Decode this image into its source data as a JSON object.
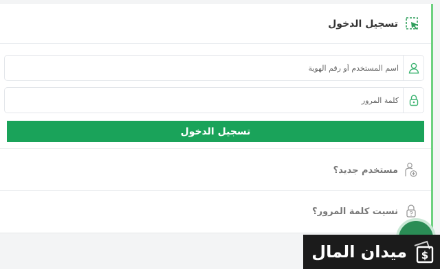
{
  "header": {
    "title": "تسجيل الدخول",
    "icon": "pointer-select-icon"
  },
  "form": {
    "username_placeholder": "اسم المستخدم أو رقم الهوية",
    "password_placeholder": "كلمة المرور",
    "submit_label": "تسجيل الدخول"
  },
  "links": {
    "new_user": "مستخدم جديد؟",
    "forgot_password": "نسيت كلمة المرور؟"
  },
  "watermark": {
    "text": "ميدان المال"
  },
  "colors": {
    "accent": "#1aa35a",
    "accent_light": "#6dd17f",
    "icon_green": "#3cb371"
  }
}
